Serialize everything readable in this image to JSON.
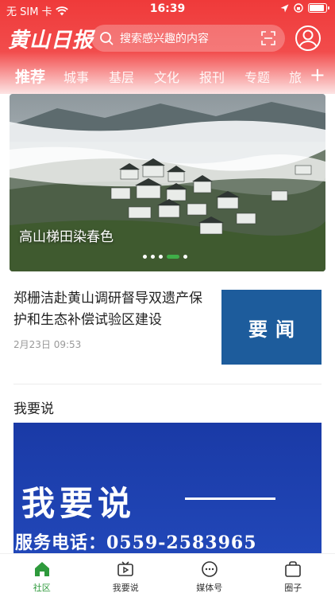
{
  "status_bar": {
    "carrier": "无 SIM 卡",
    "time": "16:39",
    "battery_level": 0.8
  },
  "header": {
    "logo_text": "黄山日报",
    "search_placeholder": "搜索感兴趣的内容",
    "icons": [
      "search-icon",
      "scan-icon",
      "user-icon"
    ]
  },
  "tabs": [
    {
      "label": "推荐",
      "active": true
    },
    {
      "label": "城事",
      "active": false
    },
    {
      "label": "基层",
      "active": false
    },
    {
      "label": "文化",
      "active": false
    },
    {
      "label": "报刊",
      "active": false
    },
    {
      "label": "专题",
      "active": false
    },
    {
      "label": "旅",
      "active": false
    }
  ],
  "banner": {
    "caption": "高山梯田染春色",
    "dot_count": 5,
    "active_dot": 3
  },
  "article": {
    "title": "郑栅洁赴黄山调研督导双遗产保护和生态补偿试验区建设",
    "date": "2月23日 09:53",
    "tag": "要闻"
  },
  "section": {
    "title": "我要说",
    "promo_heading": "我要说",
    "promo_phone": "服务电话：0559-2583965"
  },
  "bottom_nav": [
    {
      "label": "社区",
      "icon": "home-icon",
      "active": true
    },
    {
      "label": "我要说",
      "icon": "video-icon",
      "active": false
    },
    {
      "label": "媒体号",
      "icon": "chat-icon",
      "active": false
    },
    {
      "label": "圈子",
      "icon": "bag-icon",
      "active": false
    }
  ],
  "colors": {
    "header_red": "#ef3a3a",
    "accent_green": "#2e9a3c",
    "tag_blue": "#1d5c9c",
    "promo_blue": "#1a3aa6"
  }
}
